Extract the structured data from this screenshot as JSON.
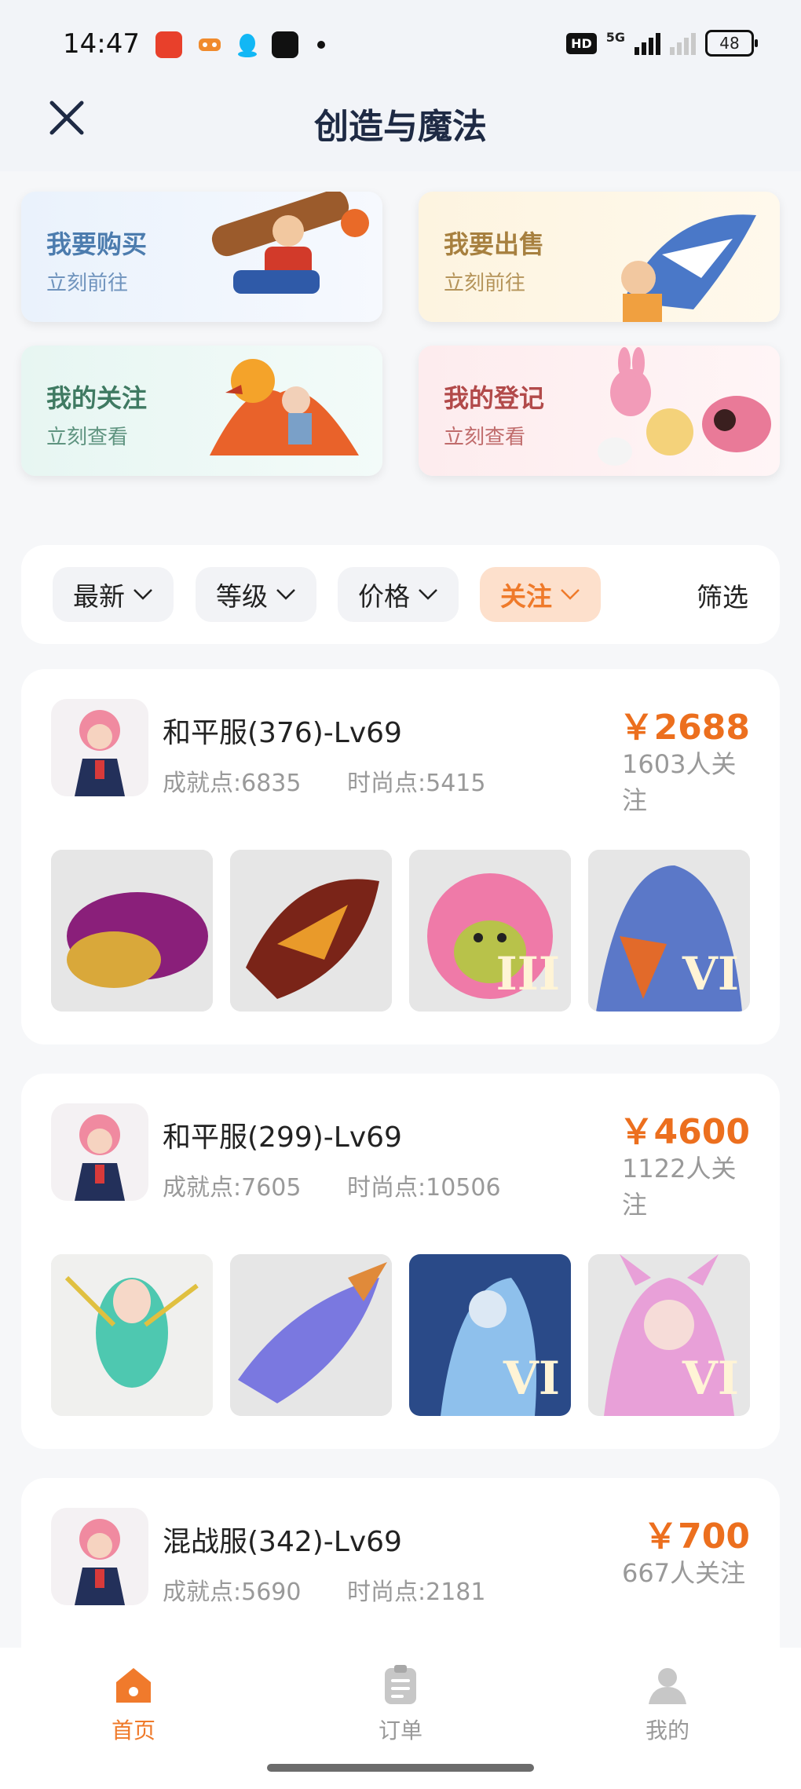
{
  "status_bar": {
    "time": "14:47",
    "network": "5G",
    "hd_label": "HD",
    "battery": "48"
  },
  "header": {
    "title": "创造与魔法",
    "close_icon": "close-icon"
  },
  "quick_actions": [
    {
      "title": "我要购买",
      "subtitle": "立刻前往",
      "color": "#4c7cae",
      "bg": "#e8f1fb"
    },
    {
      "title": "我要出售",
      "subtitle": "立刻前往",
      "color": "#a7803f",
      "bg": "#fdf3df"
    },
    {
      "title": "我的关注",
      "subtitle": "立刻查看",
      "color": "#3f7a62",
      "bg": "#e6f5f1"
    },
    {
      "title": "我的登记",
      "subtitle": "立刻查看",
      "color": "#b24a4a",
      "bg": "#fdecea"
    }
  ],
  "filters": {
    "chips": [
      "最新",
      "等级",
      "价格",
      "关注"
    ],
    "active": "关注",
    "filter_label": "筛选"
  },
  "listings": [
    {
      "server": "和平服(376)-Lv69",
      "achievement": "成就点:6835",
      "fashion": "时尚点:5415",
      "price": "￥2688",
      "followers": "1603人关注",
      "thumbs": [
        "",
        "",
        "III",
        "VI"
      ]
    },
    {
      "server": "和平服(299)-Lv69",
      "achievement": "成就点:7605",
      "fashion": "时尚点:10506",
      "price": "￥4600",
      "followers": "1122人关注",
      "thumbs": [
        "",
        "",
        "VI",
        "VI"
      ]
    },
    {
      "server": "混战服(342)-Lv69",
      "achievement": "成就点:5690",
      "fashion": "时尚点:2181",
      "price": "￥700",
      "followers": "667人关注",
      "thumbs": []
    }
  ],
  "tab_bar": {
    "tabs": [
      {
        "label": "首页",
        "icon": "home-icon",
        "active": true
      },
      {
        "label": "订单",
        "icon": "clipboard-icon",
        "active": false
      },
      {
        "label": "我的",
        "icon": "user-icon",
        "active": false
      }
    ]
  }
}
